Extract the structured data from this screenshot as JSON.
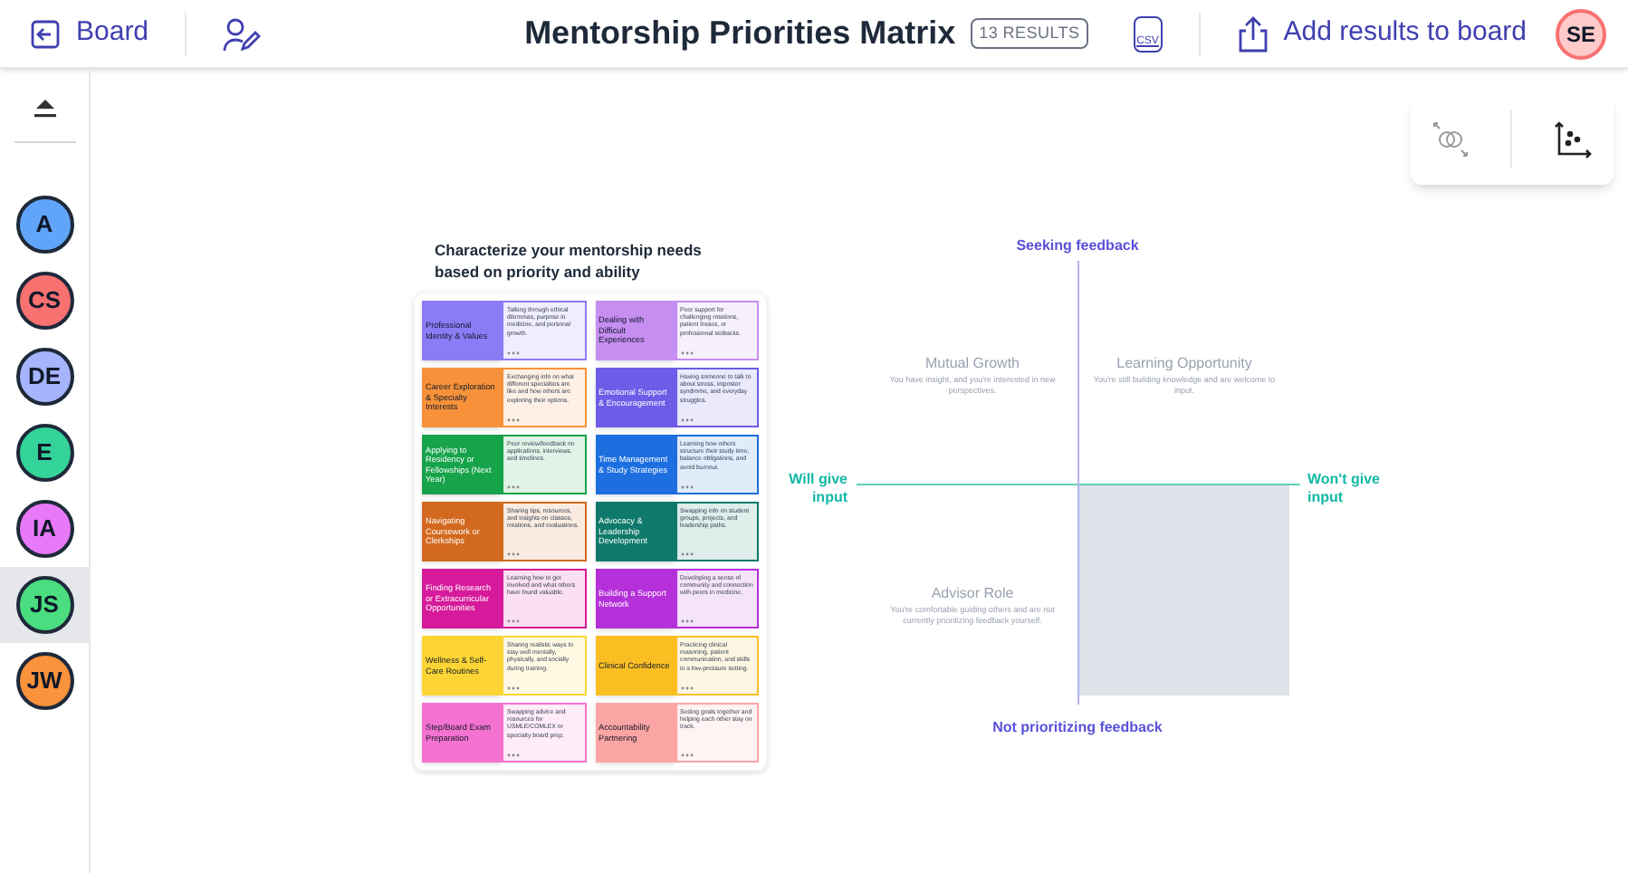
{
  "header": {
    "back_label": "Board",
    "title": "Mentorship Priorities Matrix",
    "results_badge": "13 RESULTS",
    "csv_label": "CSV",
    "add_button": "Add results to board",
    "user_initials": "SE"
  },
  "participants": [
    {
      "initials": "A",
      "color": "#60a5fa",
      "selected": false
    },
    {
      "initials": "CS",
      "color": "#f87171",
      "selected": false
    },
    {
      "initials": "DE",
      "color": "#a5b4fc",
      "selected": false
    },
    {
      "initials": "E",
      "color": "#34d399",
      "selected": false
    },
    {
      "initials": "IA",
      "color": "#e879f9",
      "selected": false
    },
    {
      "initials": "JS",
      "color": "#4ade80",
      "selected": true
    },
    {
      "initials": "JW",
      "color": "#fb923c",
      "selected": false
    }
  ],
  "prompt": {
    "title": "Characterize your mentorship needs based on priority and ability",
    "cards": [
      {
        "title": "Professional Identity & Values",
        "description": "Talking through ethical dilemmas, purpose in medicine, and personal growth.",
        "color": "#8b7cf6",
        "dark_text": true
      },
      {
        "title": "Dealing with Difficult Experiences",
        "description": "Peer support for challenging rotations, patient losses, or professional setbacks.",
        "color": "#c58ef0",
        "dark_text": true
      },
      {
        "title": "Career Exploration & Specialty Interests",
        "description": "Exchanging info on what different specialties are like and how others are exploring their options.",
        "color": "#f7923a",
        "dark_text": true
      },
      {
        "title": "Emotional Support & Encouragement",
        "description": "Having someone to talk to about stress, imposter syndrome, and everyday struggles.",
        "color": "#6c5ce7",
        "dark_text": false
      },
      {
        "title": "Applying to Residency or Fellowships (Next Year)",
        "description": "Peer review/feedback on applications, interviews, and timelines.",
        "color": "#16a34a",
        "dark_text": false
      },
      {
        "title": "Time Management & Study Strategies",
        "description": "Learning how others structure their study time, balance obligations, and avoid burnout.",
        "color": "#1d6fe0",
        "dark_text": false
      },
      {
        "title": "Navigating Coursework or Clerkships",
        "description": "Sharing tips, resources, and insights on classes, rotations, and evaluations.",
        "color": "#d2691e",
        "dark_text": false
      },
      {
        "title": "Advocacy & Leadership Development",
        "description": "Swapping info on student groups, projects, and leadership paths.",
        "color": "#0f7a6b",
        "dark_text": false
      },
      {
        "title": "Finding Research or Extracurricular Opportunities",
        "description": "Learning how to get involved and what others have found valuable.",
        "color": "#d61a9b",
        "dark_text": false
      },
      {
        "title": "Building a Support Network",
        "description": "Developing a sense of community and connection with peers in medicine.",
        "color": "#b530d9",
        "dark_text": false
      },
      {
        "title": "Wellness & Self-Care Routines",
        "description": "Sharing realistic ways to stay well mentally, physically, and socially during training.",
        "color": "#fcd535",
        "dark_text": true
      },
      {
        "title": "Clinical Confidence",
        "description": "Practicing clinical reasoning, patient communication, and skills in a low-pressure setting.",
        "color": "#fbbf24",
        "dark_text": true
      },
      {
        "title": "Step/Board Exam Preparation",
        "description": "Swapping advice and resources for USMLE/COMLEX or specialty board prep.",
        "color": "#f472d0",
        "dark_text": true
      },
      {
        "title": "Accountability Partnering",
        "description": "Setting goals together and helping each other stay on track.",
        "color": "#fca5a5",
        "dark_text": true
      }
    ]
  },
  "matrix": {
    "top_label": "Seeking feedback",
    "bottom_label": "Not prioritizing feedback",
    "left_label": "Will give input",
    "right_label": "Won't give input",
    "quadrants": [
      {
        "title": "Mutual Growth",
        "description": "You have insight, and you're interested in new perspectives.",
        "highlighted": false
      },
      {
        "title": "Learning Opportunity",
        "description": "You're still building knowledge and are welcome to input.",
        "highlighted": false
      },
      {
        "title": "Advisor Role",
        "description": "You're comfortable guiding others and are not currently prioritizing feedback yourself.",
        "highlighted": false
      },
      {
        "highlighted": true
      }
    ]
  }
}
